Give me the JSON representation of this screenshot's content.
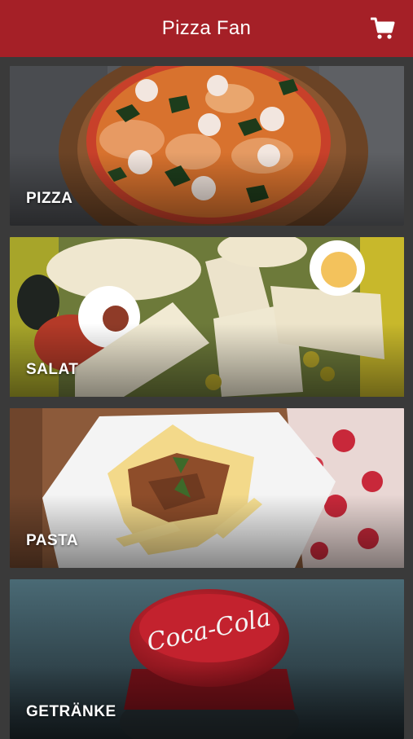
{
  "header": {
    "title": "Pizza Fan",
    "cart_icon": "shopping-cart-icon"
  },
  "colors": {
    "brand": "#a52027",
    "background": "#3a3a3a",
    "label": "#ffffff"
  },
  "categories": [
    {
      "label": "PIZZA"
    },
    {
      "label": "SALAT"
    },
    {
      "label": "PASTA"
    },
    {
      "label": "GETRÄNKE"
    }
  ],
  "bottle_cap_text": "Coca-Cola"
}
